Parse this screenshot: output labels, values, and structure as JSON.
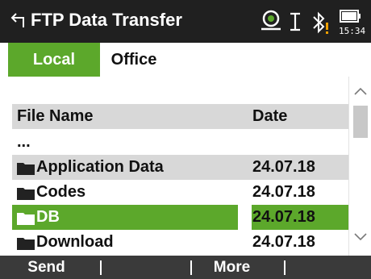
{
  "titlebar": {
    "title": "FTP Data Transfer",
    "back_icon": "back-arrow-icon",
    "status_icons": [
      "gnss-position-icon",
      "text-cursor-icon",
      "bluetooth-warning-icon",
      "battery-icon"
    ],
    "clock": "15:34"
  },
  "tabs": [
    {
      "label": "Local",
      "active": true
    },
    {
      "label": "Office",
      "active": false
    }
  ],
  "table": {
    "headers": {
      "name": "File Name",
      "date": "Date"
    },
    "parent_row": "...",
    "rows": [
      {
        "name": "Application Data",
        "date": "24.07.18",
        "icon": "folder-icon"
      },
      {
        "name": "Codes",
        "date": "24.07.18",
        "icon": "folder-icon"
      },
      {
        "name": "DB",
        "date": "24.07.18",
        "icon": "folder-icon",
        "selected": true
      },
      {
        "name": "Download",
        "date": "24.07.18",
        "icon": "folder-icon"
      }
    ]
  },
  "softkeys": [
    "Send",
    "",
    "More",
    ""
  ],
  "colors": {
    "accent": "#5ca82b",
    "titlebar": "#202020",
    "softkey_bar": "#3a3a3a",
    "row_shade": "#d8d8d8"
  }
}
